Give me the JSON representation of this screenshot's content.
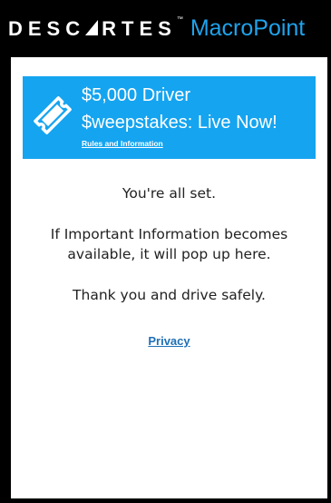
{
  "header": {
    "brand": "DESCARTES",
    "brand_prefix": "DESC",
    "brand_suffix": "RTES",
    "trademark": "™",
    "product": "MacroPoint",
    "product_color": "#1fa3ec"
  },
  "banner": {
    "icon": "ticket-icon",
    "line1": "$5,000 Driver",
    "line2": "$weepstakes: Live Now!",
    "link": "Rules and Information",
    "color": "#15a4f0"
  },
  "messages": {
    "status": "You're all set.",
    "info_line1": "If Important Information becomes",
    "info_line2": "available, it will pop up here.",
    "thanks": "Thank you and drive safely."
  },
  "footer": {
    "privacy_link": "Privacy",
    "link_color": "#1f6fb5"
  }
}
